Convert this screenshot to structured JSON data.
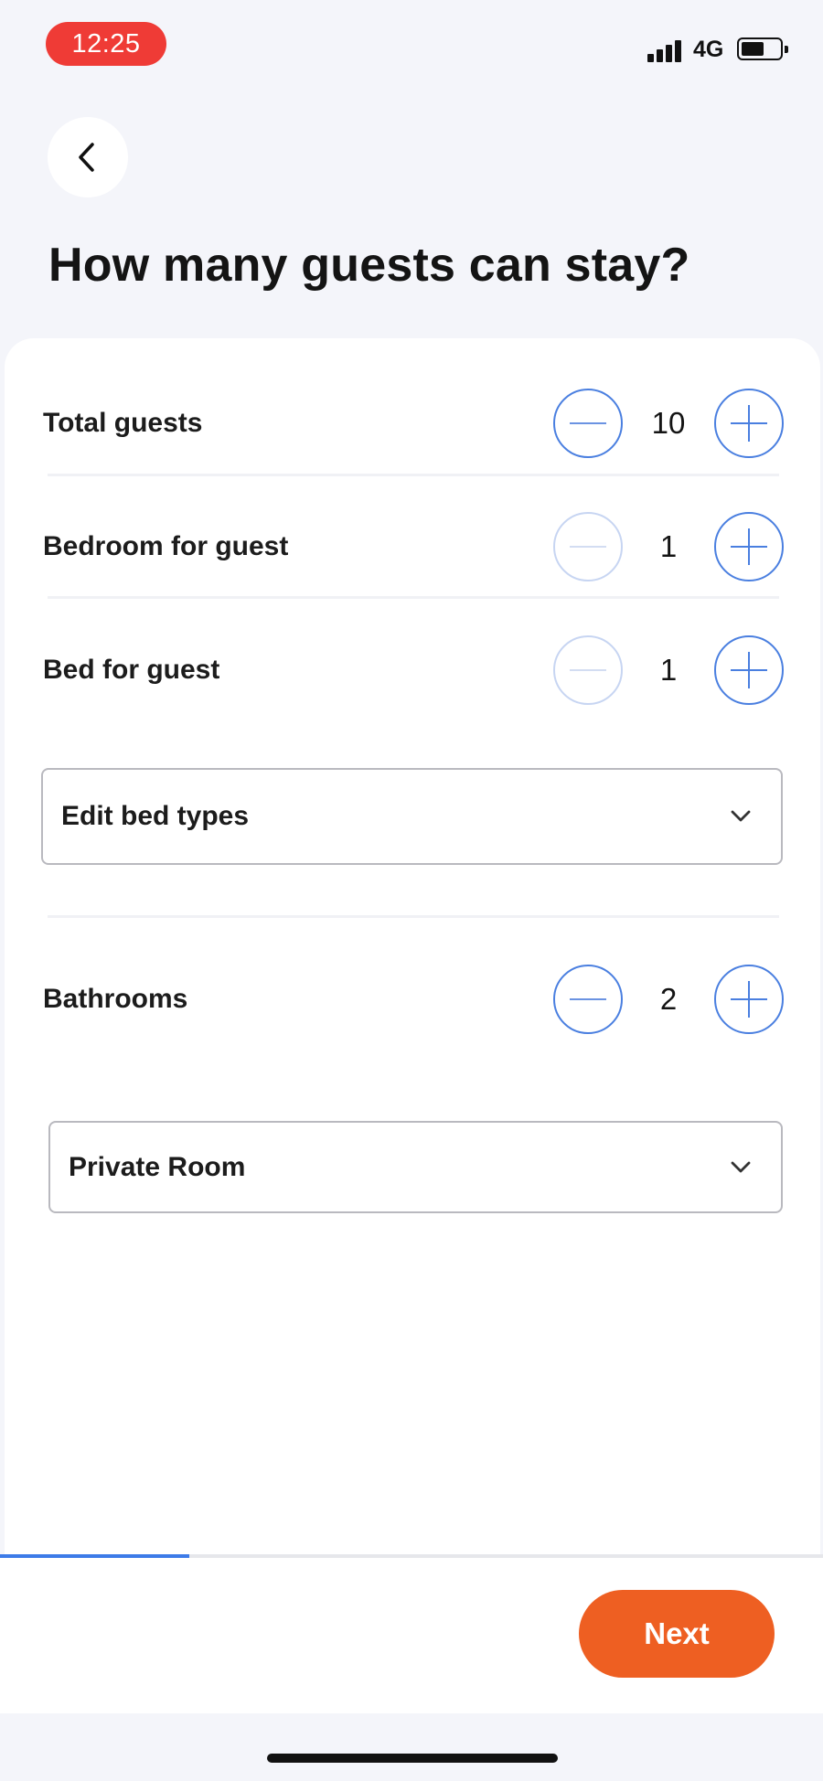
{
  "status_bar": {
    "time": "12:25",
    "network": "4G",
    "battery_level": 0.6
  },
  "header": {
    "back_icon": "chevron-left-icon",
    "title": "How many guests can stay?"
  },
  "counters": [
    {
      "label": "Total guests",
      "value": "10",
      "minus_enabled": true
    },
    {
      "label": "Bedroom for guest",
      "value": "1",
      "minus_enabled": false
    },
    {
      "label": "Bed for guest",
      "value": "1",
      "minus_enabled": false
    },
    {
      "label": "Bathrooms",
      "value": "2",
      "minus_enabled": true
    }
  ],
  "bed_types_dropdown": {
    "label": "Edit bed types",
    "icon": "chevron-down-icon"
  },
  "room_type_dropdown": {
    "selected": "Private Room",
    "icon": "chevron-down-icon"
  },
  "progress": {
    "fraction": 0.23,
    "color": "#3d7be8"
  },
  "footer": {
    "next_label": "Next",
    "next_color": "#ee5f22"
  },
  "colors": {
    "accent": "#4a7fe0",
    "background": "#f4f5fa",
    "status_pill": "#ef3b36"
  }
}
